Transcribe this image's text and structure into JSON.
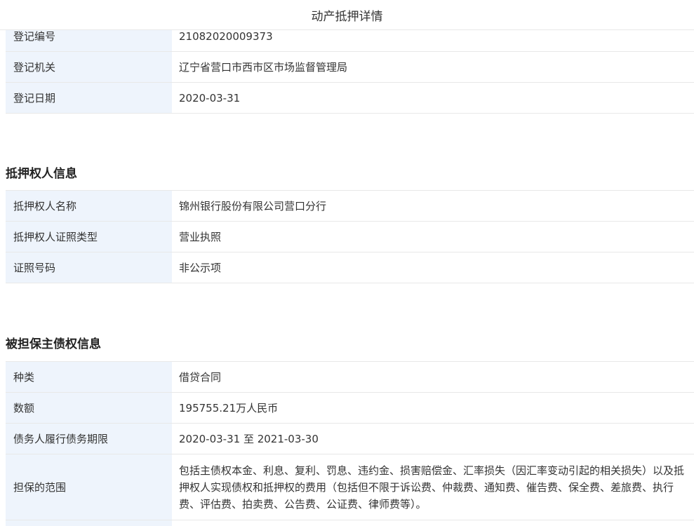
{
  "modal": {
    "title": "动产抵押详情"
  },
  "registration": {
    "rows": [
      {
        "label": "登记编号",
        "value": "21082020009373"
      },
      {
        "label": "登记机关",
        "value": "辽宁省营口市西市区市场监督管理局"
      },
      {
        "label": "登记日期",
        "value": "2020-03-31"
      }
    ]
  },
  "mortgagee": {
    "title": "抵押权人信息",
    "rows": [
      {
        "label": "抵押权人名称",
        "value": "锦州银行股份有限公司营口分行"
      },
      {
        "label": "抵押权人证照类型",
        "value": "营业执照"
      },
      {
        "label": "证照号码",
        "value": "非公示项"
      }
    ]
  },
  "secured_claim": {
    "title": "被担保主债权信息",
    "rows": [
      {
        "label": "种类",
        "value": "借贷合同"
      },
      {
        "label": "数额",
        "value": "195755.21万人民币"
      },
      {
        "label": "债务人履行债务期限",
        "value": "2020-03-31 至 2021-03-30"
      },
      {
        "label": "担保的范围",
        "value": "包括主债权本金、利息、复利、罚息、违约金、损害赔偿金、汇率损失（因汇率变动引起的相关损失）以及抵押权人实现债权和抵押权的费用（包括但不限于诉讼费、仲裁费、通知费、催告费、保全费、差旅费、执行费、评估费、拍卖费、公告费、公证费、律师费等）。"
      }
    ]
  }
}
